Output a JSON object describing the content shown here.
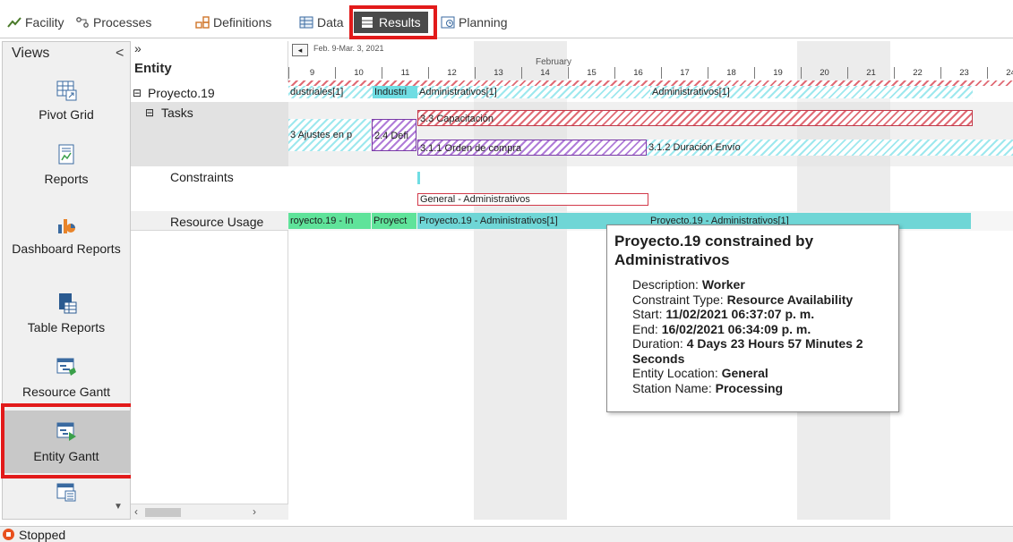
{
  "ribbon": {
    "tabs": [
      {
        "label": "Facility",
        "icon": "facility-icon"
      },
      {
        "label": "Processes",
        "icon": "processes-icon"
      },
      {
        "label": "Definitions",
        "icon": "definitions-icon"
      },
      {
        "label": "Data",
        "icon": "data-icon"
      },
      {
        "label": "Results",
        "icon": "results-icon"
      },
      {
        "label": "Planning",
        "icon": "planning-icon"
      }
    ],
    "active_tab": "Results",
    "highlight_color": "#e21a1a"
  },
  "views": {
    "title": "Views",
    "collapse_glyph": "<",
    "items": [
      {
        "label": "Pivot Grid",
        "icon": "pivot-grid-icon"
      },
      {
        "label": "Reports",
        "icon": "reports-icon"
      },
      {
        "label": "Dashboard Reports",
        "icon": "dashboard-reports-icon"
      },
      {
        "label": "Table Reports",
        "icon": "table-reports-icon"
      },
      {
        "label": "Resource Gantt",
        "icon": "resource-gantt-icon"
      },
      {
        "label": "Entity Gantt",
        "icon": "entity-gantt-icon"
      },
      {
        "label": "",
        "icon": "more-views-icon"
      }
    ],
    "active_item": "Entity Gantt"
  },
  "tree": {
    "expand_glyph": "»",
    "header": "Entity",
    "rows": [
      {
        "toggle": "⊟",
        "label": "Proyecto.19"
      },
      {
        "toggle": "⊟",
        "label": "Tasks"
      },
      {
        "toggle": "",
        "label": "Constraints"
      },
      {
        "toggle": "",
        "label": "Resource Usage"
      }
    ]
  },
  "gantt": {
    "date_range": "Feb. 9-Mar. 3, 2021",
    "month": "February",
    "days": [
      "9",
      "10",
      "11",
      "12",
      "13",
      "14",
      "15",
      "16",
      "17",
      "18",
      "19",
      "20",
      "21",
      "22",
      "23",
      "24"
    ],
    "bars": {
      "entity_1": "dustriales[1]",
      "entity_2": "Industri",
      "entity_3": "Administrativos[1]",
      "entity_4": "Administrativos[1]",
      "task_1": "3.3 Capacitación",
      "task_2": "3 Ajustes en p",
      "task_3": "2.4 Defi",
      "task_4": "3.1.1 Orden de compra",
      "task_5": "3.1.2 Duración Envío",
      "constraint_1": "General - Administrativos",
      "usage_1": "royecto.19 - In",
      "usage_2": "Proyect",
      "usage_3": "Proyecto.19 - Administrativos[1]",
      "usage_4": "Proyecto.19 - Administrativos[1]"
    },
    "colors": {
      "hatch_red": "#e06b75",
      "cyan": "#6fdde3",
      "purple": "#b07cd8",
      "green": "#5fe39a"
    }
  },
  "tooltip": {
    "title": "Proyecto.19 constrained by Administrativos",
    "lines": [
      {
        "label": "Description: ",
        "value": "Worker"
      },
      {
        "label": "Constraint Type: ",
        "value": "Resource Availability"
      },
      {
        "label": "Start: ",
        "value": "11/02/2021 06:37:07 p. m."
      },
      {
        "label": "End: ",
        "value": "16/02/2021 06:34:09 p. m."
      },
      {
        "label": "Duration: ",
        "value": "4 Days 23 Hours 57 Minutes 2 Seconds"
      },
      {
        "label": "Entity Location: ",
        "value": "General"
      },
      {
        "label": "Station Name: ",
        "value": "Processing"
      }
    ]
  },
  "status": {
    "text": "Stopped",
    "icon": "stopped-icon",
    "color": "#e8501e"
  }
}
